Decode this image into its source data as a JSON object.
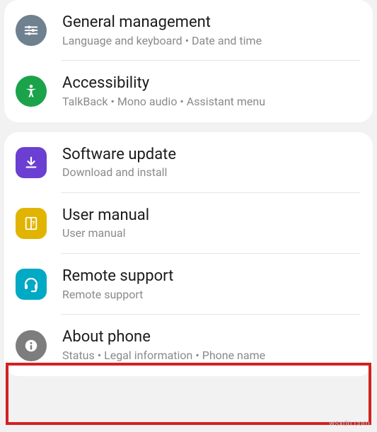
{
  "groups": [
    {
      "items": [
        {
          "id": "general",
          "title": "General management",
          "sub": "Language and keyboard  •  Date and time",
          "icon": "sliders",
          "color": "ic-blue-grey"
        },
        {
          "id": "accessibility",
          "title": "Accessibility",
          "sub": "TalkBack  •  Mono audio  •  Assistant menu",
          "icon": "person",
          "color": "ic-green"
        }
      ]
    },
    {
      "items": [
        {
          "id": "software",
          "title": "Software update",
          "sub": "Download and install",
          "icon": "download",
          "color": "ic-purple"
        },
        {
          "id": "manual",
          "title": "User manual",
          "sub": "User manual",
          "icon": "help-book",
          "color": "ic-yellow"
        },
        {
          "id": "remote",
          "title": "Remote support",
          "sub": "Remote support",
          "icon": "headset",
          "color": "ic-cyan"
        },
        {
          "id": "about",
          "title": "About phone",
          "sub": "Status  •  Legal information  •  Phone name",
          "icon": "info",
          "color": "ic-grey"
        }
      ]
    }
  ],
  "watermark": "wsxdn.com"
}
